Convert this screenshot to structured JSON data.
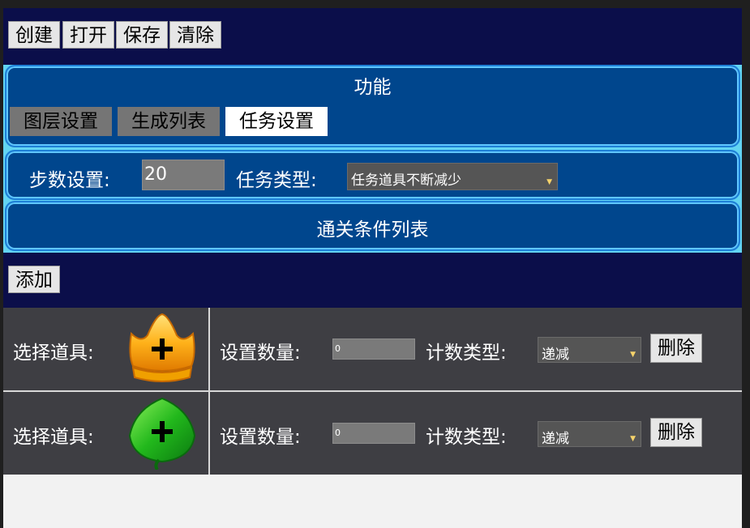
{
  "toolbar": {
    "create": "创建",
    "open": "打开",
    "save": "保存",
    "clear": "清除"
  },
  "function_panel": {
    "title": "功能",
    "tabs": [
      {
        "label": "图层设置",
        "active": false
      },
      {
        "label": "生成列表",
        "active": false
      },
      {
        "label": "任务设置",
        "active": true
      }
    ]
  },
  "task_panel": {
    "steps_label": "步数设置:",
    "steps_value": "20",
    "type_label": "任务类型:",
    "type_value": "任务道具不断减少"
  },
  "conditions_panel": {
    "title": "通关条件列表"
  },
  "add_button": "添加",
  "condition_rows": [
    {
      "select_label": "选择道具:",
      "item_icon": "crown-icon",
      "count_label": "设置数量:",
      "count_value": "0",
      "count_type_label": "计数类型:",
      "count_type_value": "递减",
      "delete_label": "删除"
    },
    {
      "select_label": "选择道具:",
      "item_icon": "leaf-icon",
      "count_label": "设置数量:",
      "count_value": "0",
      "count_type_label": "计数类型:",
      "count_type_value": "递减",
      "delete_label": "删除"
    }
  ],
  "colors": {
    "app_bg": "#0b0e4a",
    "panel_bg": "#00468d",
    "panel_border": "#5fc6ff",
    "row_bg": "#3e3e43"
  }
}
